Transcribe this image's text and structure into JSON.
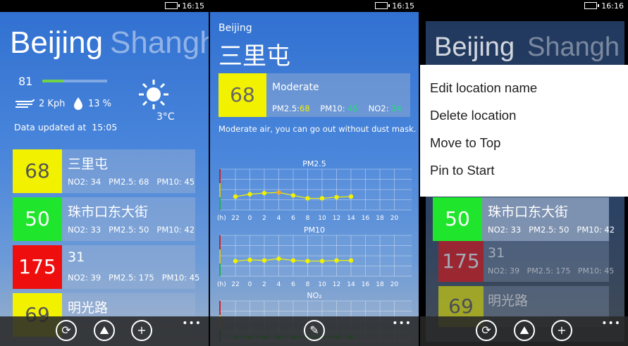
{
  "status": {
    "time": "16:15",
    "time3": "16:16"
  },
  "list": {
    "city_current": "Beijing",
    "city_next": "Shangh",
    "aqi_value": "81",
    "wind": "2 Kph",
    "humidity": "13 %",
    "temperature": "3°C",
    "updated_label": "Data updated at",
    "updated_time": "15:05",
    "aqi_progress": 0.33,
    "locations": [
      {
        "aqi": "68",
        "name": "三里屯",
        "no2": "NO2: 34",
        "pm25": "PM2.5: 68",
        "pm10": "PM10: 45",
        "color": "#f2f200",
        "text_color": "#555555"
      },
      {
        "aqi": "50",
        "name": "珠市口东大街",
        "no2": "NO2: 33",
        "pm25": "PM2.5: 50",
        "pm10": "PM10: 42",
        "color": "#1fe62c",
        "text_color": "#ffffff"
      },
      {
        "aqi": "175",
        "name": "31",
        "no2": "NO2: 39",
        "pm25": "PM2.5: 175",
        "pm10": "PM10: 45",
        "color": "#ee0e0e",
        "text_color": "#ffffff"
      },
      {
        "aqi": "69",
        "name": "明光路",
        "color": "#f2f200",
        "text_color": "#555555"
      }
    ]
  },
  "detail": {
    "city": "Beijing",
    "location": "三里屯",
    "aqi": "68",
    "level": "Moderate",
    "pm25_label": "PM2.5:",
    "pm25_value": "68",
    "pm10_label": "PM10:",
    "pm10_value": "45",
    "no2_label": "NO2:",
    "no2_value": "34",
    "advice": "Moderate air, you can go out without dust mask.",
    "chart_titles": [
      "PM2.5",
      "PM10",
      "NO₂"
    ],
    "hour_prefix": "(h)",
    "hours": [
      "22",
      "0",
      "2",
      "4",
      "6",
      "8",
      "10",
      "12",
      "14",
      "16",
      "18",
      "20"
    ]
  },
  "menu": {
    "items": [
      "Edit location name",
      "Delete location",
      "Move to Top",
      "Pin to Start"
    ]
  },
  "colors": {
    "yellow": "#f2f200",
    "green": "#1fe62c",
    "red": "#ee0e0e",
    "orange": "#f5a623",
    "accent_green": "#19e36f"
  },
  "icons": [
    "refresh-icon",
    "map-icon",
    "add-icon",
    "edit-icon",
    "sun-icon",
    "wind-icon",
    "droplet-icon",
    "more-icon"
  ]
}
